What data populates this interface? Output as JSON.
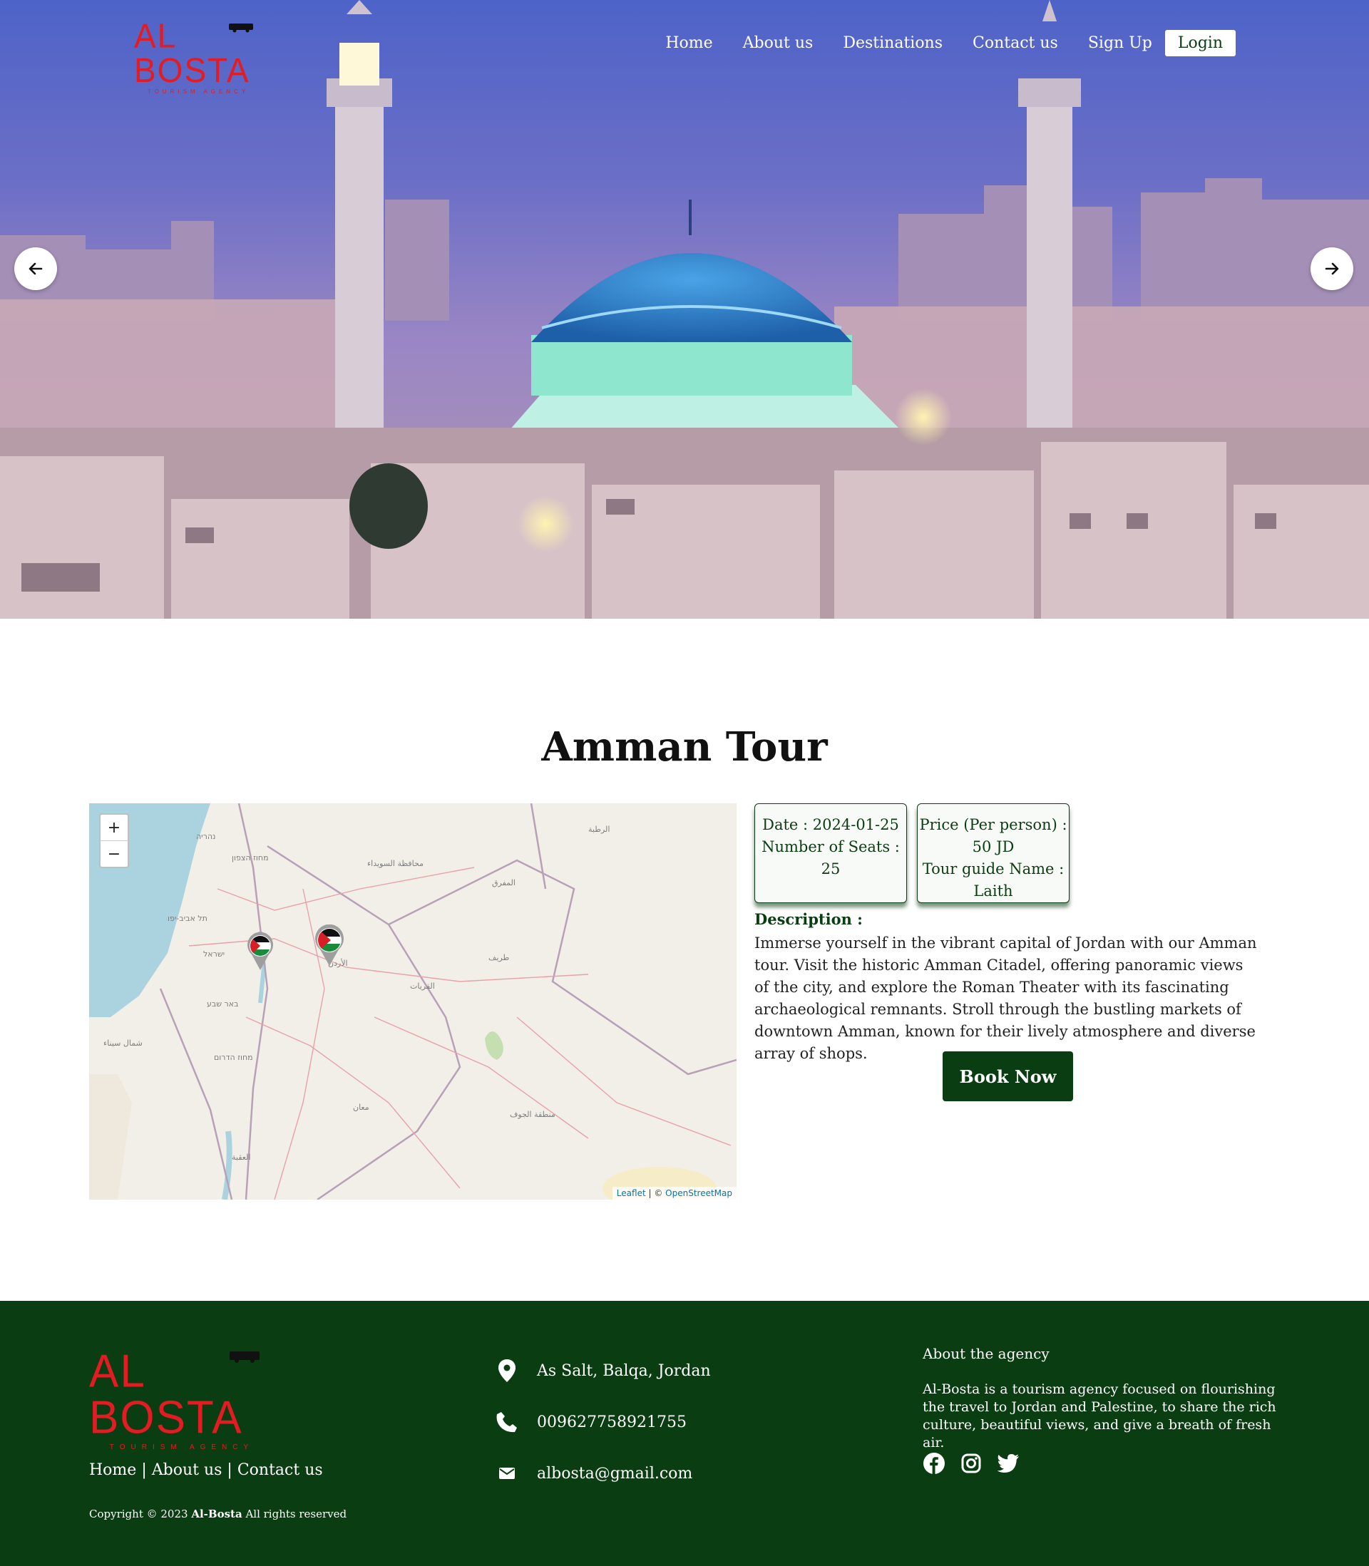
{
  "brand": {
    "name": "AL BOSTA",
    "tagline": "TOURISM AGENCY",
    "color": "#e31b23"
  },
  "nav": {
    "links": [
      "Home",
      "About us",
      "Destinations",
      "Contact us",
      "Sign Up"
    ],
    "login_label": "Login"
  },
  "hero": {
    "prev_icon": "arrow-left-icon",
    "next_icon": "arrow-right-icon"
  },
  "tour": {
    "title": "Amman Tour",
    "date_label": "Date : 2024-01-25",
    "seats_label": "Number of Seats :",
    "seats_value": "25",
    "price_label": "Price (Per person) :",
    "price_value": "50 JD",
    "guide_label": "Tour guide Name :",
    "guide_value": "Laith",
    "description_label": "Description :",
    "description": "Immerse yourself in the vibrant capital of Jordan with our Amman tour. Visit the historic Amman Citadel, offering panoramic views of the city, and explore the Roman Theater with its fascinating archaeological remnants. Stroll through the bustling markets of downtown Amman, known for their lively atmosphere and diverse array of shops.",
    "book_label": "Book Now"
  },
  "map": {
    "zoom_in": "+",
    "zoom_out": "−",
    "attribution_leaflet": "Leaflet",
    "attribution_sep": " | © ",
    "attribution_osm": "OpenStreetMap",
    "markers": [
      "palestine-flag-marker",
      "jordan-flag-marker"
    ]
  },
  "footer": {
    "links": [
      "Home",
      "About us",
      "Contact us"
    ],
    "copyright_prefix": "Copyright © 2023 ",
    "copyright_brand": "Al-Bosta",
    "copyright_suffix": " All rights reserved",
    "address": "As Salt, Balqa, Jordan",
    "phone": "009627758921755",
    "email": "albosta@gmail.com",
    "about_title": "About the agency",
    "about_text": "Al-Bosta is a tourism agency focused on flourishing the travel to Jordan and Palestine, to share the rich culture, beautiful views, and give a breath of fresh air.",
    "social": [
      "facebook-icon",
      "instagram-icon",
      "twitter-icon"
    ]
  },
  "colors": {
    "primary": "#0b3d12",
    "accent": "#e31b23"
  }
}
